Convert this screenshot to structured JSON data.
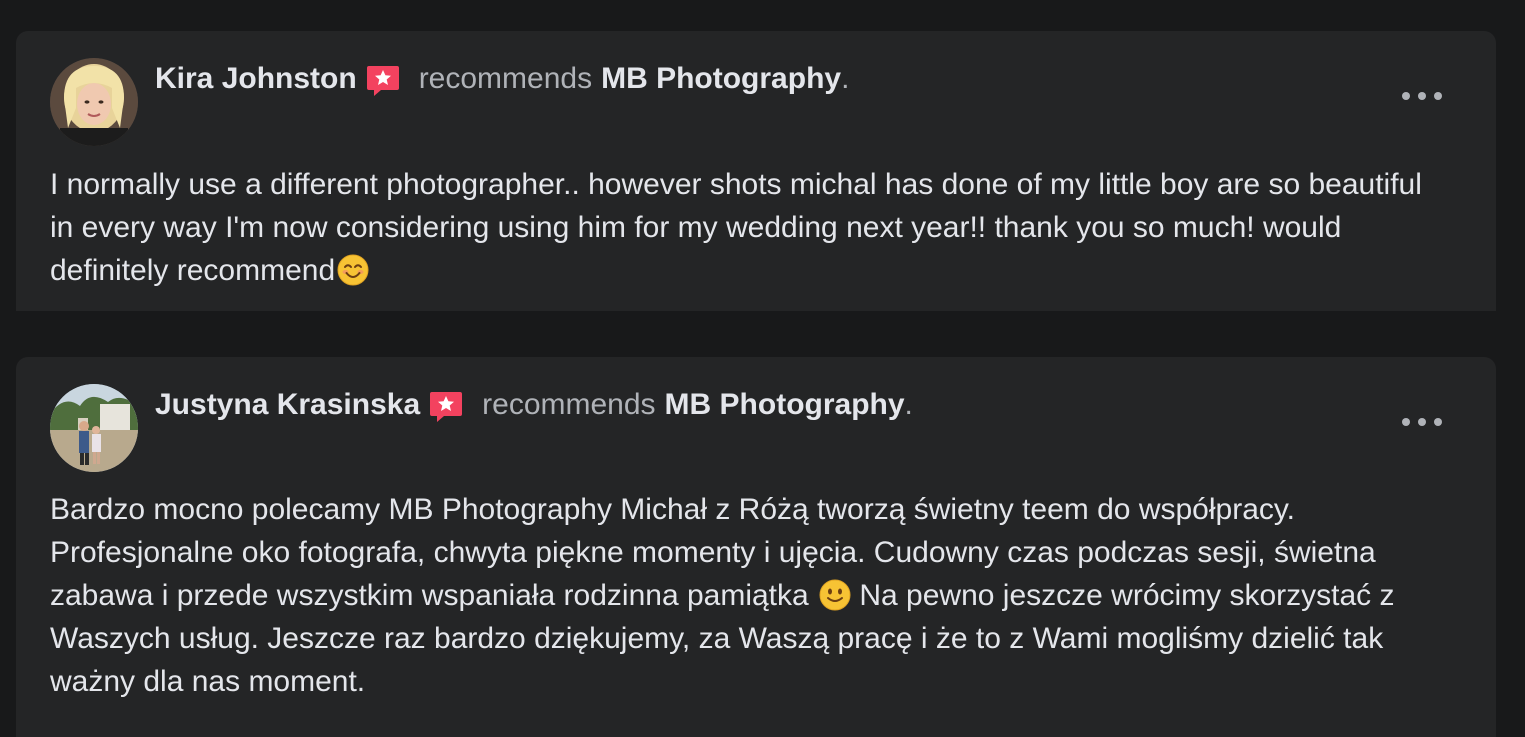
{
  "reviews": [
    {
      "author": "Kira Johnston",
      "verb": "recommends",
      "page": "MB Photography",
      "period": ".",
      "text": "I normally use a different photographer.. however shots michal has done of my little boy are so beautiful in every way I'm now considering using him for my wedding next year!! thank you so much! would definitely recommend",
      "emoji": "smiling-face-with-smiling-eyes"
    },
    {
      "author": "Justyna Krasinska",
      "verb": "recommends",
      "page": "MB Photography",
      "period": ".",
      "text_part1": "Bardzo mocno polecamy MB Photography Michał z Różą tworzą świetny teem do współpracy. Profesjonalne oko fotografa, chwyta piękne momenty i ujęcia. Cudowny czas podczas sesji, świetna zabawa i przede wszystkim wspaniała rodzinna pamiątka",
      "emoji": "slightly-smiling-face",
      "text_part2": " Na pewno jeszcze wrócimy skorzystać z Waszych usług. Jeszcze raz bardzo dziękujemy, za Waszą pracę i że to z Wami mogliśmy dzielić tak ważny dla nas moment."
    }
  ],
  "colors": {
    "background": "#18191a",
    "card": "#242526",
    "primary_text": "#e4e6eb",
    "secondary_text": "#b0b3b8",
    "recommend_badge": "#f3425f"
  },
  "icons": {
    "recommend": "recommend-star-badge-icon",
    "more": "more-options-icon"
  }
}
